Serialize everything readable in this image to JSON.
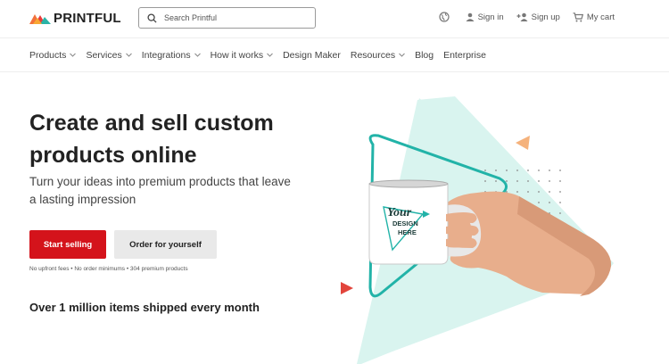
{
  "brand": {
    "name": "PRINTFUL"
  },
  "search": {
    "placeholder": "Search Printful"
  },
  "top_actions": {
    "language_icon": "globe-icon",
    "sign_in": "Sign in",
    "sign_up": "Sign up",
    "cart": "My cart"
  },
  "nav": [
    {
      "label": "Products",
      "dropdown": true
    },
    {
      "label": "Services",
      "dropdown": true
    },
    {
      "label": "Integrations",
      "dropdown": true
    },
    {
      "label": "How it works",
      "dropdown": true
    },
    {
      "label": "Design Maker",
      "dropdown": false
    },
    {
      "label": "Resources",
      "dropdown": true
    },
    {
      "label": "Blog",
      "dropdown": false
    },
    {
      "label": "Enterprise",
      "dropdown": false
    }
  ],
  "hero": {
    "title": "Create and sell custom products online",
    "subtitle": "Turn your ideas into premium products that leave a lasting impression",
    "primary_cta": "Start selling",
    "secondary_cta": "Order for yourself",
    "fine_print": "No upfront fees • No order minimums • 304 premium products",
    "shipped": "Over 1 million items shipped every month"
  },
  "mug": {
    "line1": "Your",
    "line2": "DESIGN",
    "line3": "HERE"
  },
  "colors": {
    "accent": "#d4131b",
    "teal": "#22b3a8",
    "mint": "#d9f4ef",
    "orange": "#f5b27c"
  }
}
